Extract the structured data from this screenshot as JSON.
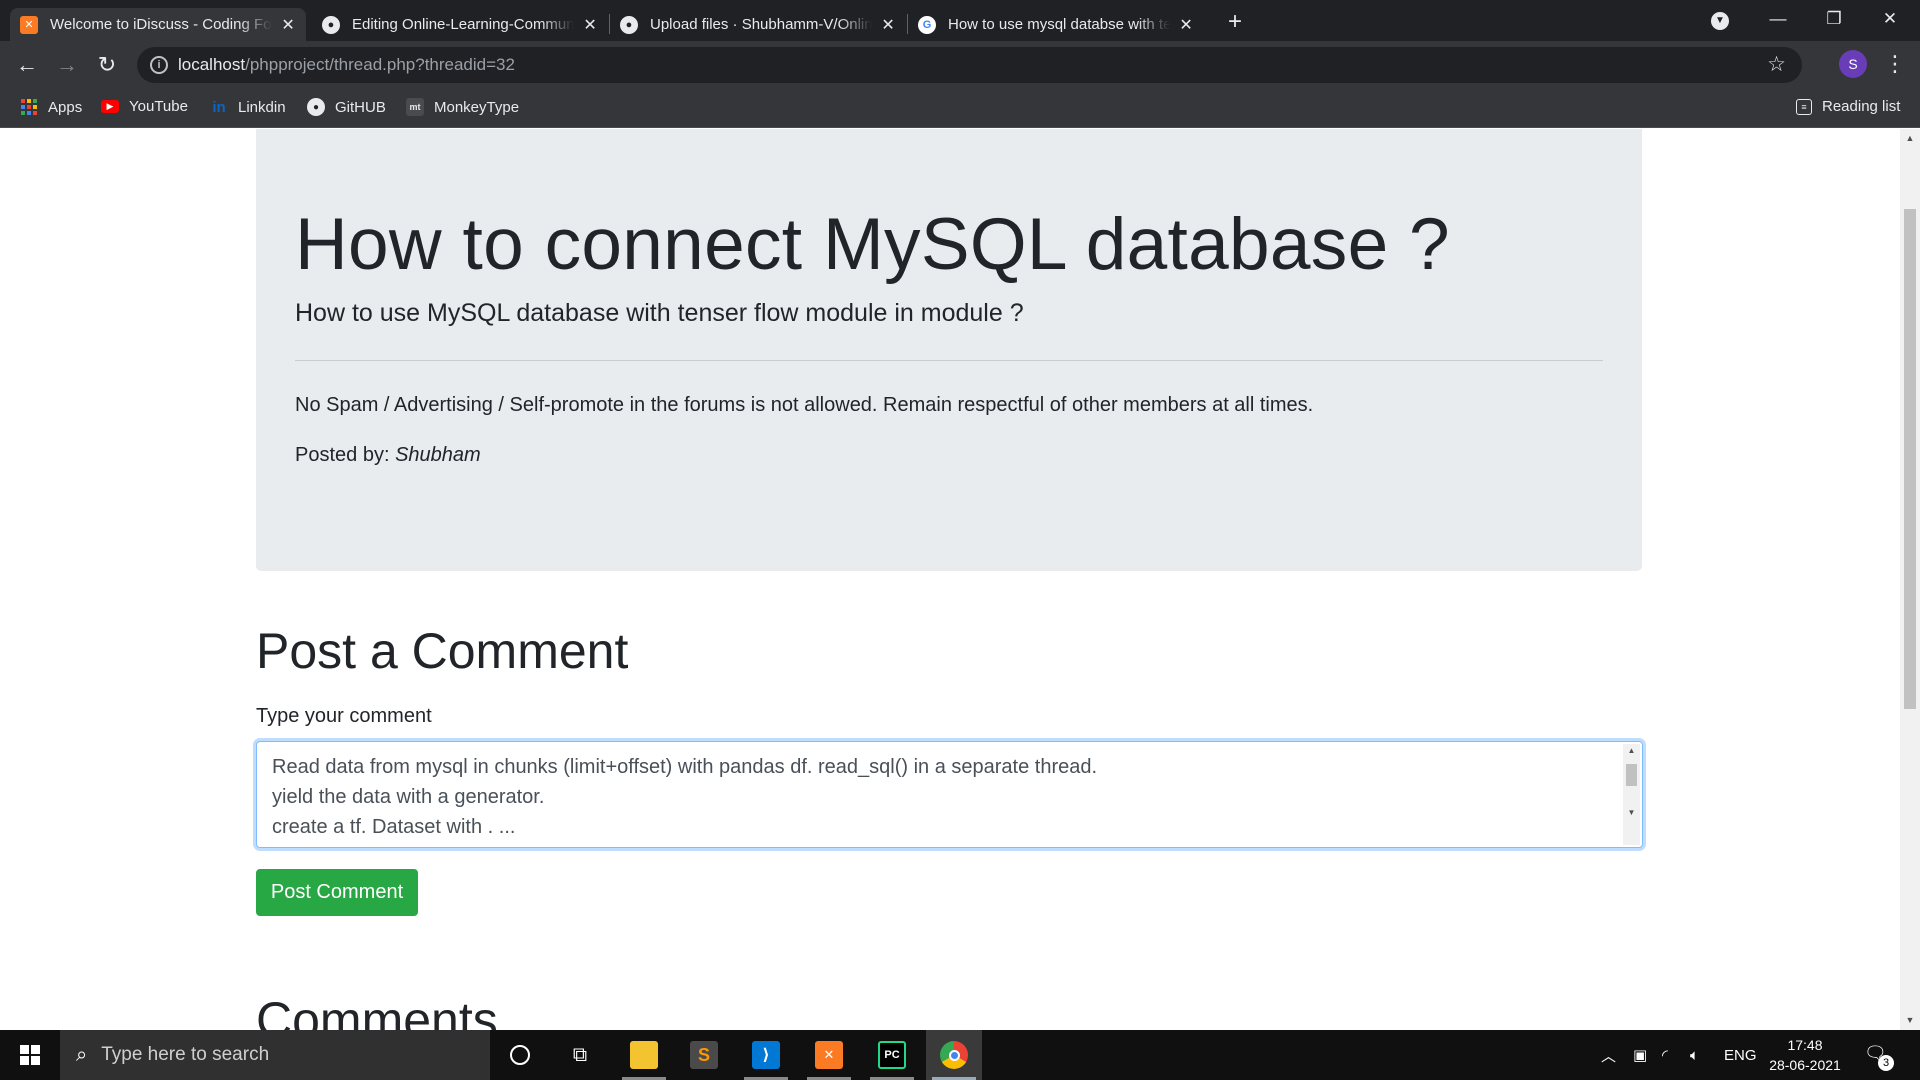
{
  "browser": {
    "tabs": [
      {
        "title": "Welcome to iDiscuss - Coding Forum",
        "icon": "xampp-icon"
      },
      {
        "title": "Editing Online-Learning-Community",
        "icon": "github-icon"
      },
      {
        "title": "Upload files · Shubhamm-V/Online-Learning",
        "icon": "github-icon"
      },
      {
        "title": "How to use mysql databse with tenser",
        "icon": "google-icon"
      }
    ],
    "address": {
      "host": "localhost",
      "path": "/phpproject/thread.php?threadid=32"
    },
    "profile_initial": "S",
    "bookmarks": [
      {
        "label": "Apps"
      },
      {
        "label": "YouTube"
      },
      {
        "label": "Linkdin"
      },
      {
        "label": "GitHUB"
      },
      {
        "label": "MonkeyType"
      }
    ],
    "reading_list": "Reading list"
  },
  "thread": {
    "title": "How to connect MySQL database ?",
    "description": "How to use MySQL database with tenser flow module in module ?",
    "rules": "No Spam / Advertising / Self-promote in the forums is not allowed. Remain respectful of other members at all times.",
    "posted_by_label": "Posted by:",
    "posted_by_user": "Shubham"
  },
  "comment_form": {
    "heading": "Post a Comment",
    "label": "Type your comment",
    "value_lines": [
      "Read data from mysql in chunks (limit+offset) with pandas df. read_sql() in a separate thread.",
      "yield the data with a generator.",
      "create a tf. Dataset with . ..."
    ],
    "submit_label": "Post Comment"
  },
  "comments": {
    "heading": "Comments"
  },
  "taskbar": {
    "search_placeholder": "Type here to search",
    "language": "ENG",
    "time": "17:48",
    "date": "28-06-2021",
    "notification_count": "3"
  }
}
